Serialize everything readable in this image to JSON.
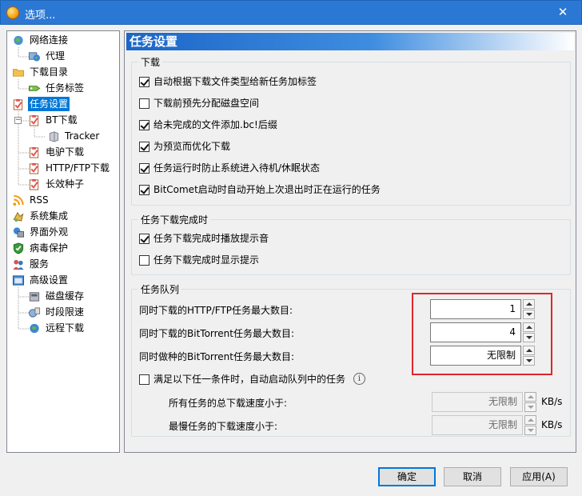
{
  "window": {
    "title": "选项...",
    "close_glyph": "✕"
  },
  "tree": [
    {
      "label": "网络连接",
      "icon": "globe-network-icon",
      "name": "tree-item-network"
    },
    {
      "label": "代理",
      "icon": "proxy-globe-icon",
      "name": "tree-item-proxy"
    },
    {
      "label": "下载目录",
      "icon": "folder-icon",
      "name": "tree-item-download-dir"
    },
    {
      "label": "任务标签",
      "icon": "tag-icon",
      "name": "tree-item-task-tags"
    },
    {
      "label": "任务设置",
      "icon": "clipboard-icon",
      "name": "tree-item-task-settings"
    },
    {
      "label": "BT下载",
      "icon": "clipboard-icon",
      "name": "tree-item-bt-download"
    },
    {
      "label": "Tracker",
      "icon": "server-icon",
      "name": "tree-item-tracker"
    },
    {
      "label": "电驴下载",
      "icon": "clipboard-icon",
      "name": "tree-item-emule"
    },
    {
      "label": "HTTP/FTP下载",
      "icon": "clipboard-icon",
      "name": "tree-item-http-ftp"
    },
    {
      "label": "长效种子",
      "icon": "clipboard-icon",
      "name": "tree-item-long-seed"
    },
    {
      "label": "RSS",
      "icon": "rss-icon",
      "name": "tree-item-rss"
    },
    {
      "label": "系统集成",
      "icon": "integration-icon",
      "name": "tree-item-integration"
    },
    {
      "label": "界面外观",
      "icon": "appearance-icon",
      "name": "tree-item-appearance"
    },
    {
      "label": "病毒保护",
      "icon": "shield-icon",
      "name": "tree-item-antivirus"
    },
    {
      "label": "服务",
      "icon": "users-icon",
      "name": "tree-item-service"
    },
    {
      "label": "高级设置",
      "icon": "advanced-icon",
      "name": "tree-item-advanced"
    },
    {
      "label": "磁盘缓存",
      "icon": "disk-icon",
      "name": "tree-item-disk-cache"
    },
    {
      "label": "时段限速",
      "icon": "speed-limit-icon",
      "name": "tree-item-schedule"
    },
    {
      "label": "远程下载",
      "icon": "remote-globe-icon",
      "name": "tree-item-remote"
    }
  ],
  "selected_tree_item": "任务设置",
  "header": {
    "title": "任务设置"
  },
  "download_group": {
    "title": "下载",
    "options": [
      {
        "label": "自动根据下载文件类型给新任务加标签",
        "checked": true
      },
      {
        "label": "下载前预先分配磁盘空间",
        "checked": false
      },
      {
        "label": "给未完成的文件添加.bc!后缀",
        "checked": true
      },
      {
        "label": "为预览而优化下载",
        "checked": true
      },
      {
        "label": "任务运行时防止系统进入待机/休眠状态",
        "checked": true
      },
      {
        "label": "BitComet启动时自动开始上次退出时正在运行的任务",
        "checked": true
      }
    ]
  },
  "complete_group": {
    "title": "任务下载完成时",
    "options": [
      {
        "label": "任务下载完成时播放提示音",
        "checked": true
      },
      {
        "label": "任务下载完成时显示提示",
        "checked": false
      }
    ]
  },
  "queue_group": {
    "title": "任务队列",
    "fields": [
      {
        "label": "同时下载的HTTP/FTP任务最大数目:",
        "value": "1"
      },
      {
        "label": "同时下载的BitTorrent任务最大数目:",
        "value": "4"
      },
      {
        "label": "同时做种的BitTorrent任务最大数目:",
        "value": "无限制"
      }
    ],
    "auto_start": {
      "label": "满足以下任一条件时，自动启动队列中的任务",
      "checked": false,
      "info": "i"
    },
    "speed_fields": [
      {
        "label": "所有任务的总下载速度小于:",
        "value": "无限制",
        "unit": "KB/s"
      },
      {
        "label": "最慢任务的下载速度小于:",
        "value": "无限制",
        "unit": "KB/s"
      }
    ]
  },
  "buttons": {
    "ok": "确定",
    "cancel": "取消",
    "apply": "应用(A)"
  }
}
